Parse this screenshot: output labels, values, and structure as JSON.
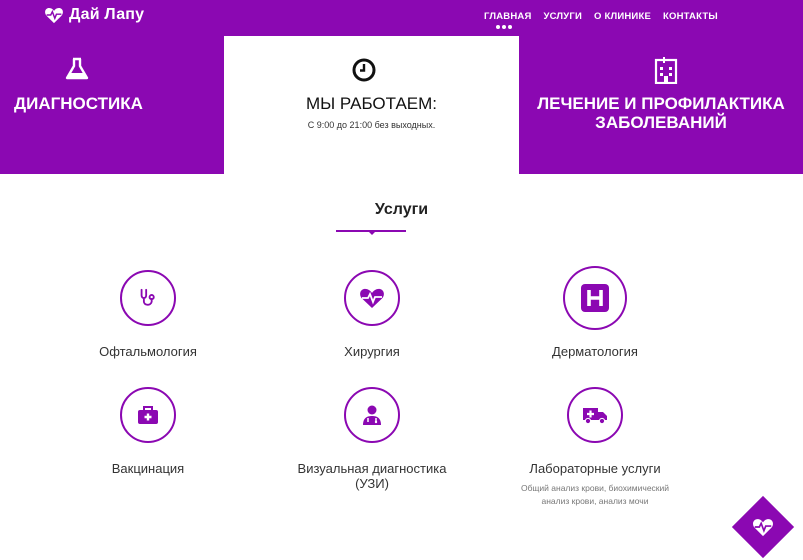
{
  "header": {
    "brand": "Дай Лапу",
    "nav": [
      "ГЛАВНАЯ",
      "УСЛУГИ",
      "О КЛИНИКЕ",
      "КОНТАКТЫ"
    ]
  },
  "features": {
    "left": {
      "title": "ДИАГНОСТИКА",
      "icon": "flask-icon"
    },
    "middle": {
      "title": "МЫ РАБОТАЕМ:",
      "subtitle": "С 9:00 до 21:00 без выходных.",
      "icon": "clock-icon"
    },
    "right": {
      "title_line1": "ЛЕЧЕНИЕ И ПРОФИЛАКТИКА",
      "title_line2": "ЗАБОЛЕВАНИЙ",
      "icon": "hospital-building-icon"
    }
  },
  "services": {
    "title": "Услуги",
    "items": [
      {
        "name": "Офтальмология",
        "icon": "stethoscope-icon"
      },
      {
        "name": "Хирургия",
        "icon": "heartbeat-icon"
      },
      {
        "name": "Дерматология",
        "icon": "hospital-h-icon"
      },
      {
        "name": "Вакцинация",
        "icon": "medkit-icon"
      },
      {
        "name_line1": "Визуальная диагностика",
        "name_line2": "(УЗИ)",
        "icon": "doctor-icon"
      },
      {
        "name": "Лабораторные услуги",
        "desc_line1": "Общий анализ крови, биохимический",
        "desc_line2": "анализ крови, анализ мочи",
        "icon": "ambulance-icon"
      }
    ]
  },
  "colors": {
    "accent": "#8b08b2",
    "text": "#333333",
    "muted": "#777777"
  }
}
